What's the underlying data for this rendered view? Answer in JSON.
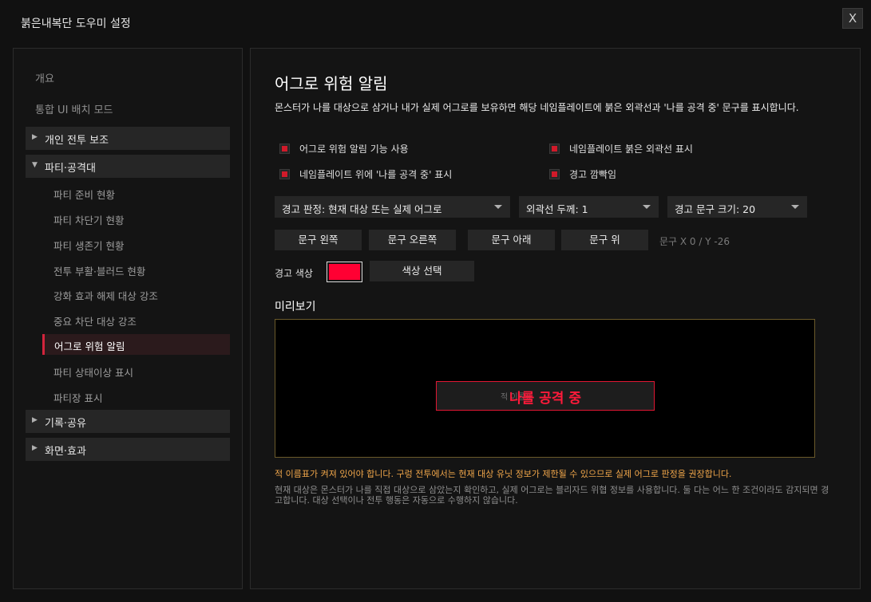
{
  "window": {
    "title": "붉은내복단 도우미 설정",
    "close_label": "X"
  },
  "sidebar": {
    "top_items": [
      "개요",
      "통합 UI 배치 모드"
    ],
    "groups": [
      {
        "label": "개인 전투 보조",
        "expanded": false
      },
      {
        "label": "파티·공격대",
        "expanded": true
      },
      {
        "label": "기록·공유",
        "expanded": false
      },
      {
        "label": "화면·효과",
        "expanded": false
      }
    ],
    "party_items": [
      "파티 준비 현황",
      "파티 차단기 현황",
      "파티 생존기 현황",
      "전투 부활·블러드 현황",
      "강화 효과 해제 대상 강조",
      "중요 차단 대상 강조",
      "어그로 위험 알림",
      "파티 상태이상 표시",
      "파티장 표시"
    ],
    "active_item": "어그로 위험 알림",
    "arrow_collapsed": "▶",
    "arrow_expanded": "▼"
  },
  "main": {
    "title": "어그로 위험 알림",
    "description": "몬스터가 나를 대상으로 삼거나 내가 실제 어그로를 보유하면 해당 네임플레이트에 붉은 외곽선과 '나를 공격 중' 문구를 표시합니다.",
    "checkboxes": [
      {
        "label": "어그로 위험 알림 기능 사용",
        "checked": true
      },
      {
        "label": "네임플레이트 붉은 외곽선 표시",
        "checked": true
      },
      {
        "label": "네임플레이트 위에 '나를 공격 중' 표시",
        "checked": true
      },
      {
        "label": "경고 깜빡임",
        "checked": true
      }
    ],
    "dropdowns": [
      {
        "label": "경고 판정: 현재 대상 또는 실제 어그로"
      },
      {
        "label": "외곽선 두께: 1"
      },
      {
        "label": "경고 문구 크기: 20"
      }
    ],
    "position_buttons": [
      "문구 왼쪽",
      "문구 오른쪽",
      "문구 아래",
      "문구 위"
    ],
    "offset_text": "문구 X 0 / Y -26",
    "color_label": "경고 색상",
    "color_value": "#ff0033",
    "color_button": "색상 선택",
    "preview_title": "미리보기",
    "preview": {
      "warning_text": "나를 공격 중",
      "nameplate_subtext": "적 이름표"
    },
    "warning_line": "적 이름표가 켜져 있어야 합니다. 구렁 전투에서는 현재 대상 유닛 정보가 제한될 수 있으므로 실제 어그로 판정을 권장합니다.",
    "info_text": "현재 대상은 몬스터가 나를 직접 대상으로 삼았는지 확인하고, 실제 어그로는 블리자드 위협 정보를 사용합니다. 둘 다는 어느 한 조건이라도 감지되면 경고합니다. 대상 선택이나 전투 행동은 자동으로 수행하지 않습니다."
  },
  "colors": {
    "accent_red": "#d11a2a",
    "warning_red": "#ff1a3a",
    "warning_orange": "#f0a64a",
    "background": "#111111",
    "panel": "#141414"
  }
}
